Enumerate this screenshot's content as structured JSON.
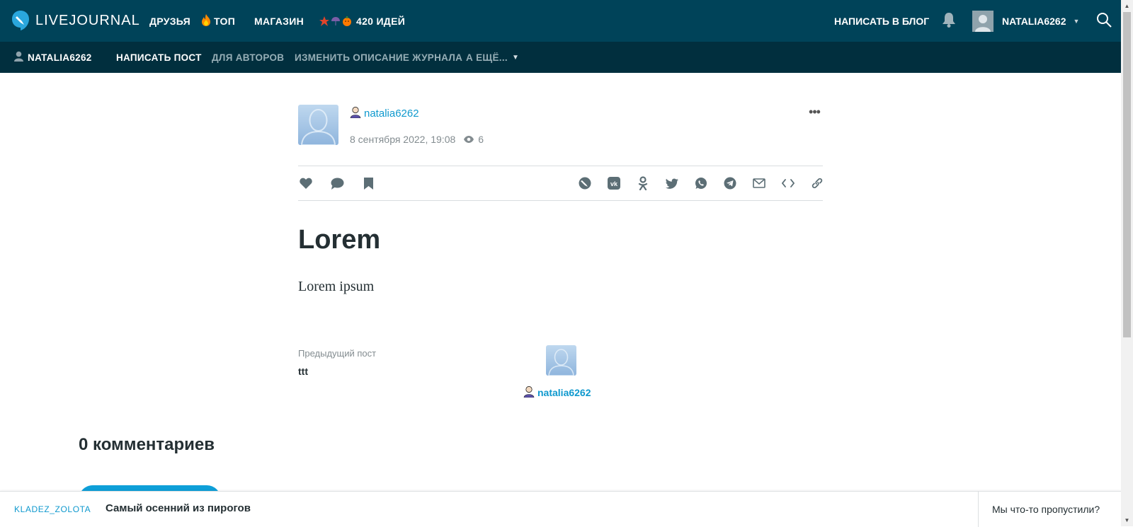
{
  "header": {
    "logo_text": "LIVEJOURNAL",
    "nav": {
      "friends": "ДРУЗЬЯ",
      "top": "ТОП",
      "shop": "МАГАЗИН",
      "ideas": "420 ИДЕЙ"
    },
    "write_blog": "НАПИСАТЬ В БЛОГ",
    "username": "NATALIA6262",
    "icons": [
      "bell-icon",
      "search-icon",
      "fire-icon",
      "chevron-down-icon"
    ]
  },
  "subnav": {
    "username": "NATALIA6262",
    "write_post": "НАПИСАТЬ ПОСТ",
    "for_authors": "ДЛЯ АВТОРОВ",
    "edit_description": "ИЗМЕНИТЬ ОПИСАНИЕ ЖУРНАЛА",
    "more": "А ЕЩЁ..."
  },
  "post": {
    "author": "natalia6262",
    "date": "8 сентября 2022, 19:08",
    "views": "6",
    "title": "Lorem",
    "body": "Lorem ipsum"
  },
  "navigation": {
    "prev_label": "Предыдущий пост",
    "prev_title": "ttt",
    "author": "natalia6262"
  },
  "comments": {
    "title": "0 комментариев"
  },
  "bottombar": {
    "author": "KLADEZ_ZOLOTA",
    "title": "Самый осенний из пирогов",
    "missed": "Мы что-то пропустили?"
  },
  "colors": {
    "header_bg": "#004359",
    "subnav_bg": "#012f3e",
    "link": "#0f99ce",
    "button": "#0e9fd8"
  }
}
